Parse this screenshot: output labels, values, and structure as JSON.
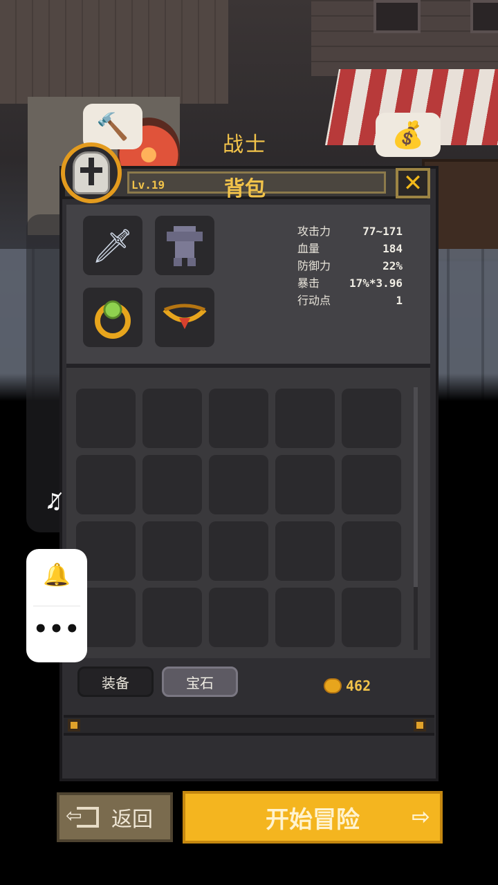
{
  "scene": {
    "class_name": "战士",
    "hammer_icon": "hammer-icon",
    "bag_icon": "money-bag-icon"
  },
  "panel": {
    "title": "背包",
    "level": "Lv.19",
    "close_icon": "close-icon"
  },
  "equipment": [
    {
      "name": "sword",
      "icon": "sword-icon"
    },
    {
      "name": "armor",
      "icon": "armor-icon"
    },
    {
      "name": "ring",
      "icon": "ring-icon"
    },
    {
      "name": "necklace",
      "icon": "necklace-icon"
    }
  ],
  "stats": [
    {
      "label": "攻击力",
      "value": "77~171"
    },
    {
      "label": "血量",
      "value": "184"
    },
    {
      "label": "防御力",
      "value": "22%"
    },
    {
      "label": "暴击",
      "value": "17%*3.96"
    },
    {
      "label": "行动点",
      "value": "1"
    }
  ],
  "inventory": {
    "rows": 4,
    "cols": 5,
    "scroll_fraction": 0.76
  },
  "tabs": {
    "equip": "装备",
    "gem": "宝石"
  },
  "gold": "462",
  "buttons": {
    "back": "返回",
    "start": "开始冒险"
  },
  "colors": {
    "accent": "#f4b51f",
    "gold_text": "#f2c34a"
  }
}
